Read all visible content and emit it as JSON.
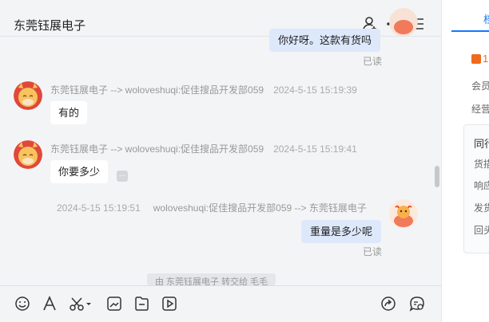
{
  "header": {
    "title": "东莞钰展电子",
    "icons": [
      "add-user-icon",
      "more-icon",
      "list-icon"
    ]
  },
  "messages": {
    "m0": {
      "text": "你好呀。这款有货吗",
      "status": "已读"
    },
    "m1": {
      "sender": "东莞钰展电子 --> woloveshuqi:促佳搜品开发部059",
      "time": "2024-5-15 15:19:39",
      "text": "有的"
    },
    "m2": {
      "sender": "东莞钰展电子 --> woloveshuqi:促佳搜品开发部059",
      "time": "2024-5-15 15:19:41",
      "text": "你要多少"
    },
    "m3": {
      "time": "2024-5-15 15:19:51",
      "sender": "woloveshuqi:促佳搜品开发部059 --> 东莞钰展电子",
      "text": "重量是多少呢",
      "status": "已读"
    }
  },
  "system_note": "由 东莞钰展电子 转交给 毛毛",
  "toolbar": {
    "left_icons": [
      "emoji-icon",
      "font-icon",
      "scissors-icon",
      "image-icon",
      "file-icon",
      "video-icon"
    ],
    "right_icons": [
      "share-icon",
      "chat-settings-icon"
    ]
  },
  "sidebar": {
    "tab": "档",
    "badge": "1",
    "row1": "会员",
    "row2": "经营",
    "panel_title": "同行",
    "panel_rows": [
      "货描",
      "响应",
      "发货",
      "回头"
    ]
  },
  "colors": {
    "accent": "#1677ff",
    "bubble_out": "#dde8fb",
    "badge_orange": "#f06a1d"
  }
}
